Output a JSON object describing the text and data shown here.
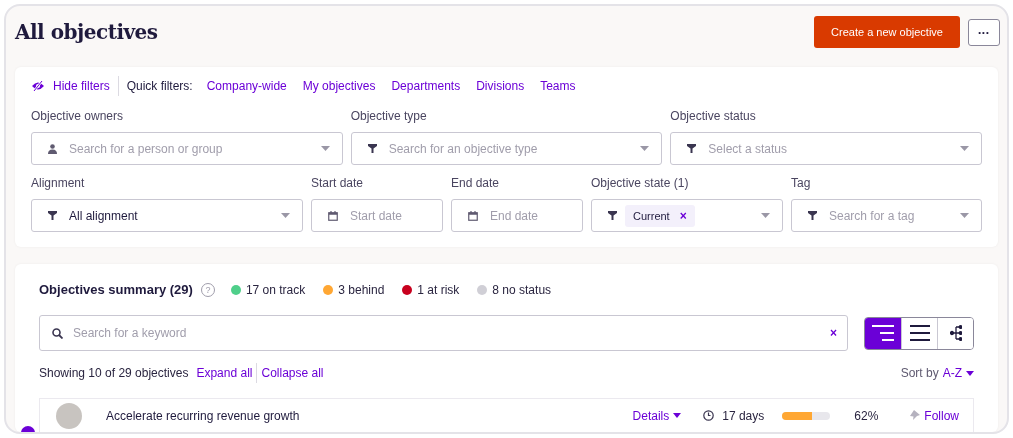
{
  "header": {
    "title": "All objectives",
    "create_button": "Create a new objective",
    "more_button": "•••"
  },
  "filters": {
    "hide_filters": "Hide filters",
    "quick_label": "Quick filters:",
    "quick": [
      "Company-wide",
      "My objectives",
      "Departments",
      "Divisions",
      "Teams"
    ],
    "row_1": [
      {
        "kind": "owner",
        "label": "Objective owners",
        "placeholder": "Search for a person or group"
      },
      {
        "kind": "select",
        "label": "Objective type",
        "placeholder": "Search for an objective type"
      },
      {
        "kind": "select",
        "label": "Objective status",
        "placeholder": "Select a status"
      }
    ],
    "row_2": [
      {
        "kind": "value",
        "label": "Alignment",
        "value": "All alignment"
      },
      {
        "kind": "date",
        "label": "Start date",
        "placeholder": "Start date"
      },
      {
        "kind": "date",
        "label": "End date",
        "placeholder": "End date"
      },
      {
        "kind": "chips",
        "label": "Objective state (1)",
        "chips": [
          "Current"
        ],
        "chip_remove": "×"
      },
      {
        "kind": "select",
        "label": "Tag",
        "placeholder": "Search for a tag"
      }
    ]
  },
  "summary": {
    "title": "Objectives summary (29)",
    "help": "?",
    "statuses": [
      {
        "label": "17 on track",
        "color": "#4fcf8a"
      },
      {
        "label": "3 behind",
        "color": "#ffa733"
      },
      {
        "label": "1 at risk",
        "color": "#c8001e"
      },
      {
        "label": "8 no status",
        "color": "#d0cfd6"
      }
    ],
    "search_placeholder": "Search for a keyword",
    "clear": "×",
    "view_modes": [
      {
        "kind": "indented",
        "selected": true
      },
      {
        "kind": "list",
        "selected": false
      },
      {
        "kind": "tree",
        "selected": false
      }
    ],
    "showing": "Showing 10 of 29 objectives",
    "expand_all": "Expand all",
    "collapse_all": "Collapse all",
    "sort_label": "Sort by",
    "sort_value": "A-Z"
  },
  "objectives": [
    {
      "title": "Accelerate recurring revenue growth",
      "details": "Details",
      "due": "17 days",
      "level": 0.62,
      "percent": "62%",
      "follow": "Follow"
    }
  ]
}
